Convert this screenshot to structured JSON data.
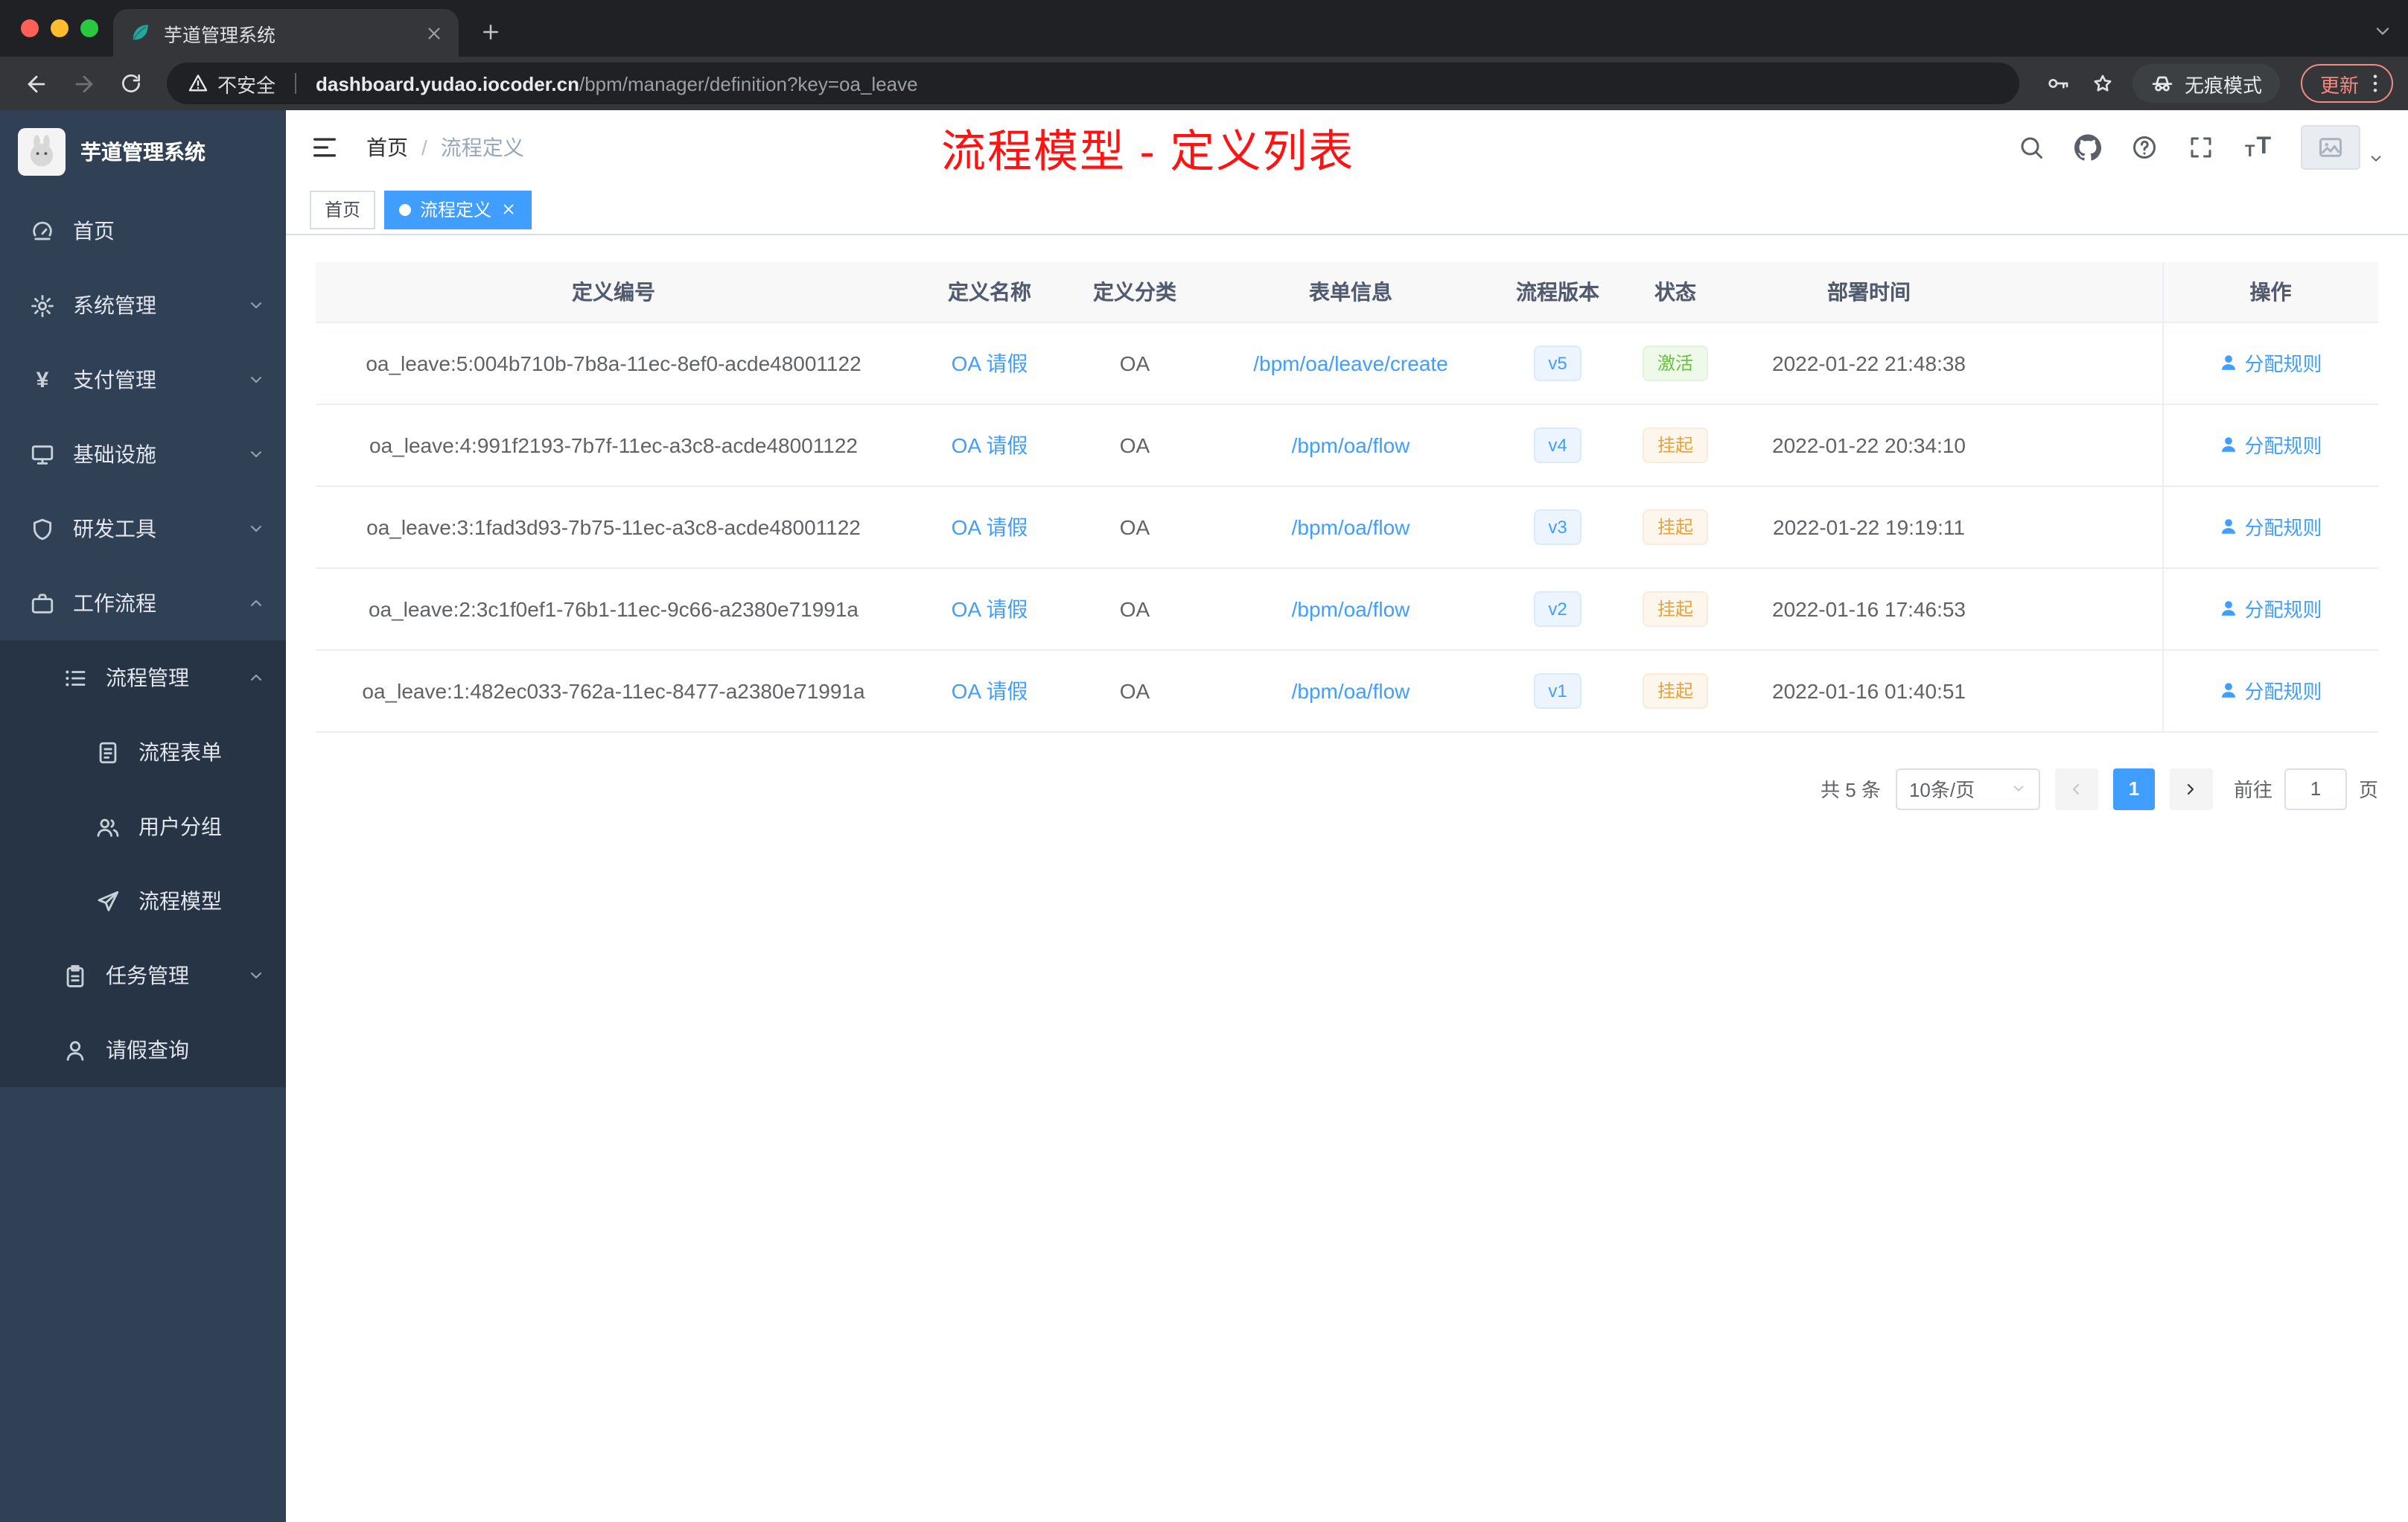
{
  "browser": {
    "tab_title": "芋道管理系统",
    "security_label": "不安全",
    "url_host": "dashboard.yudao.iocoder.cn",
    "url_path": "/bpm/manager/definition?key=oa_leave",
    "incognito_label": "无痕模式",
    "update_label": "更新"
  },
  "sidebar": {
    "app_title": "芋道管理系统",
    "menu": [
      {
        "label": "首页",
        "icon": "dashboard-icon"
      },
      {
        "label": "系统管理",
        "icon": "gear-icon"
      },
      {
        "label": "支付管理",
        "icon": "yen-icon"
      },
      {
        "label": "基础设施",
        "icon": "monitor-icon"
      },
      {
        "label": "研发工具",
        "icon": "shield-icon"
      },
      {
        "label": "工作流程",
        "icon": "briefcase-icon"
      },
      {
        "label": "流程管理",
        "icon": "list-icon"
      },
      {
        "label": "流程表单",
        "icon": "form-icon"
      },
      {
        "label": "用户分组",
        "icon": "users-icon"
      },
      {
        "label": "流程模型",
        "icon": "send-icon"
      },
      {
        "label": "任务管理",
        "icon": "task-icon"
      },
      {
        "label": "请假查询",
        "icon": "user-icon"
      }
    ]
  },
  "header": {
    "breadcrumb_home": "首页",
    "breadcrumb_sep": "/",
    "breadcrumb_current": "流程定义",
    "annotation": "流程模型 - 定义列表"
  },
  "tags_view": {
    "tags": [
      {
        "label": "首页",
        "active": false
      },
      {
        "label": "流程定义",
        "active": true
      }
    ]
  },
  "table": {
    "columns": [
      "定义编号",
      "定义名称",
      "定义分类",
      "表单信息",
      "流程版本",
      "状态",
      "部署时间",
      "操作"
    ],
    "rows": [
      {
        "id": "oa_leave:5:004b710b-7b8a-11ec-8ef0-acde48001122",
        "name": "OA 请假",
        "category": "OA",
        "form": "/bpm/oa/leave/create",
        "version": "v5",
        "status": "激活",
        "status_type": "success",
        "deploy_time": "2022-01-22 21:48:38",
        "action": "分配规则"
      },
      {
        "id": "oa_leave:4:991f2193-7b7f-11ec-a3c8-acde48001122",
        "name": "OA 请假",
        "category": "OA",
        "form": "/bpm/oa/flow",
        "version": "v4",
        "status": "挂起",
        "status_type": "warning",
        "deploy_time": "2022-01-22 20:34:10",
        "action": "分配规则"
      },
      {
        "id": "oa_leave:3:1fad3d93-7b75-11ec-a3c8-acde48001122",
        "name": "OA 请假",
        "category": "OA",
        "form": "/bpm/oa/flow",
        "version": "v3",
        "status": "挂起",
        "status_type": "warning",
        "deploy_time": "2022-01-22 19:19:11",
        "action": "分配规则"
      },
      {
        "id": "oa_leave:2:3c1f0ef1-76b1-11ec-9c66-a2380e71991a",
        "name": "OA 请假",
        "category": "OA",
        "form": "/bpm/oa/flow",
        "version": "v2",
        "status": "挂起",
        "status_type": "warning",
        "deploy_time": "2022-01-16 17:46:53",
        "action": "分配规则"
      },
      {
        "id": "oa_leave:1:482ec033-762a-11ec-8477-a2380e71991a",
        "name": "OA 请假",
        "category": "OA",
        "form": "/bpm/oa/flow",
        "version": "v1",
        "status": "挂起",
        "status_type": "warning",
        "deploy_time": "2022-01-16 01:40:51",
        "action": "分配规则"
      }
    ]
  },
  "pagination": {
    "total_text": "共 5 条",
    "page_size": "10条/页",
    "current_page": "1",
    "goto_label": "前往",
    "goto_value": "1",
    "goto_suffix": "页"
  },
  "colors": {
    "accent": "#409eff",
    "success": "#67c23a",
    "warning": "#e6a23c",
    "annotation_red": "#ff1212",
    "sidebar_bg": "#304156",
    "submenu_bg": "#263445",
    "chrome_bg": "#202124",
    "toolbar_bg": "#35363a"
  }
}
